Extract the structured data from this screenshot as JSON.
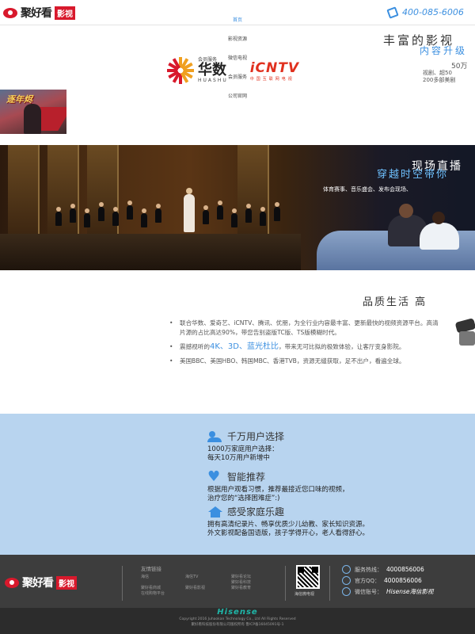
{
  "header": {
    "logo_text": "聚好看",
    "logo_badge": "影视",
    "hotline": "400-085-6006"
  },
  "nav": {
    "items": [
      {
        "label": "首页",
        "active": true
      },
      {
        "label": "影视资源",
        "active": false
      },
      {
        "label": "微信电视",
        "active": false
      },
      {
        "label": "会员服务",
        "active": false
      },
      {
        "label": "公司官网",
        "active": false
      }
    ]
  },
  "section1": {
    "title": "丰富的影视",
    "subtitle": "内容升级",
    "line1": "50万",
    "line2": "视剧、超50",
    "line3": "200多部美剧",
    "partners": {
      "huashu_small": "会员服务",
      "huashu_big": "华数",
      "huashu_en": "HUASHU",
      "icntv_logo": "iCNTV",
      "icntv_sub": "中国互联网电视"
    },
    "poster_title": "逐年烬"
  },
  "banner": {
    "title": "现场直播",
    "subtitle": "穿越时空带你",
    "tags": "体育赛事、音乐盛会、发布会现场、"
  },
  "section3": {
    "heading": "品质生活   高",
    "bullets": [
      {
        "text": "联合华数、爱奇艺、iCNTV、腾讯、优朋，为全行业内容最丰富、更新最快的视频资源平台。高清片源的占比高达90%，带您告别盗版TC版、TS版模糊时代。"
      },
      {
        "pre": "震撼视听的",
        "hl": "4K、3D、蓝光杜比",
        "post": "，带来无可比拟的极致体验，让客厅变身影院。"
      },
      {
        "text": "美国BBC、美国HBO、韩国MBC、香港TVB，资源无缝获取，足不出户，看遍全球。"
      }
    ]
  },
  "features": [
    {
      "icon": "users-icon",
      "title": "千万用户选择",
      "desc": [
        "1000万家庭用户选择：",
        "每天10万用户新增中"
      ]
    },
    {
      "icon": "heart-icon",
      "title": "智能推荐",
      "desc": [
        "根据用户观看习惯，推荐最接近您口味的视频，",
        "治疗您的“选择困难症”:)"
      ]
    },
    {
      "icon": "home-icon",
      "title": "感受家庭乐趣",
      "desc": [
        "拥有高清纪录片、畅享优质少儿幼教、家长知识资源。",
        "外文影视配备国语版，孩子学得开心，老人看得舒心。"
      ]
    }
  ],
  "footer": {
    "logo_text": "聚好看",
    "logo_badge": "影视",
    "links_heading": "友情链接",
    "links": [
      "海信",
      "海信TV",
      "聚好看论坛",
      "聚好看商城",
      "聚好看影视",
      "聚好看科技",
      "在线购物平台",
      "聚好看教育"
    ],
    "qr_label": "海信微电视",
    "contacts": [
      {
        "label": "服务热线：",
        "value": "4000856006"
      },
      {
        "label": "官方QQ：",
        "value": "4000856006"
      },
      {
        "label": "微信账号：",
        "value": "Hisense海信影视"
      }
    ],
    "brand": "Hisense",
    "copyright": "Copyright 2016 Juhaokan Technology Co., Ltd All Rights Reserved",
    "icp": "聚好看科技股份有限公司版权所有 鲁ICP备16045091号-1"
  }
}
